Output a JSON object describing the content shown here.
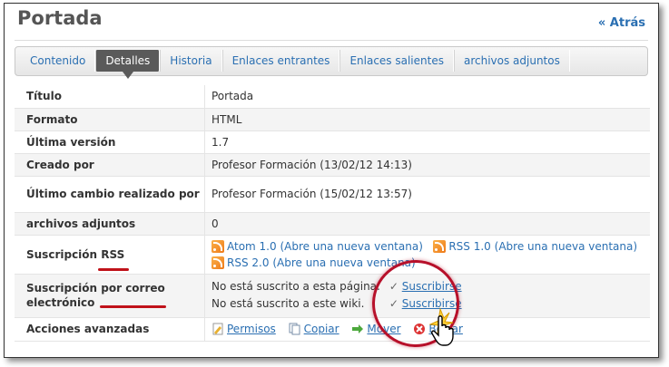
{
  "page": {
    "title": "Portada",
    "back_label": "« Atrás"
  },
  "tabs": [
    {
      "label": "Contenido",
      "active": false
    },
    {
      "label": "Detalles",
      "active": true
    },
    {
      "label": "Historia",
      "active": false
    },
    {
      "label": "Enlaces entrantes",
      "active": false
    },
    {
      "label": "Enlaces salientes",
      "active": false
    },
    {
      "label": "archivos adjuntos",
      "active": false
    }
  ],
  "details": {
    "titulo": {
      "label": "Título",
      "value": "Portada"
    },
    "formato": {
      "label": "Formato",
      "value": "HTML"
    },
    "ultima_version": {
      "label": "Última versión",
      "value": "1.7"
    },
    "creado_por": {
      "label": "Creado por",
      "value": "Profesor Formación (13/02/12 14:13)"
    },
    "ultimo_cambio": {
      "label": "Último cambio realizado por",
      "value": "Profesor Formación (15/02/12 13:57)"
    },
    "adjuntos": {
      "label": "archivos adjuntos",
      "value": "0"
    },
    "rss": {
      "label_prefix": "Suscripción",
      "label_highlight": "RSS",
      "atom": "Atom 1.0",
      "atom_note": "(Abre una nueva ventana)",
      "rss1": "RSS 1.0",
      "rss1_note": "(Abre una nueva ventana)",
      "rss2": "RSS 2.0",
      "rss2_note": "(Abre una nueva ventana)"
    },
    "email": {
      "label_prefix": "Suscripción",
      "label_highlight": "por correo",
      "label_suffix": "electrónico",
      "page_status": "No está suscrito a esta página.",
      "page_action": "Suscribirse",
      "wiki_status": "No está suscrito a este wiki.",
      "wiki_action": "Suscribirse"
    },
    "acciones": {
      "label": "Acciones avanzadas",
      "permisos": "Permisos",
      "copiar": "Copiar",
      "mover": "Mover",
      "borrar": "Borrar"
    }
  },
  "colors": {
    "link": "#2a6fb2",
    "accent_red": "#c0121a",
    "tab_active": "#5a5a5a"
  }
}
